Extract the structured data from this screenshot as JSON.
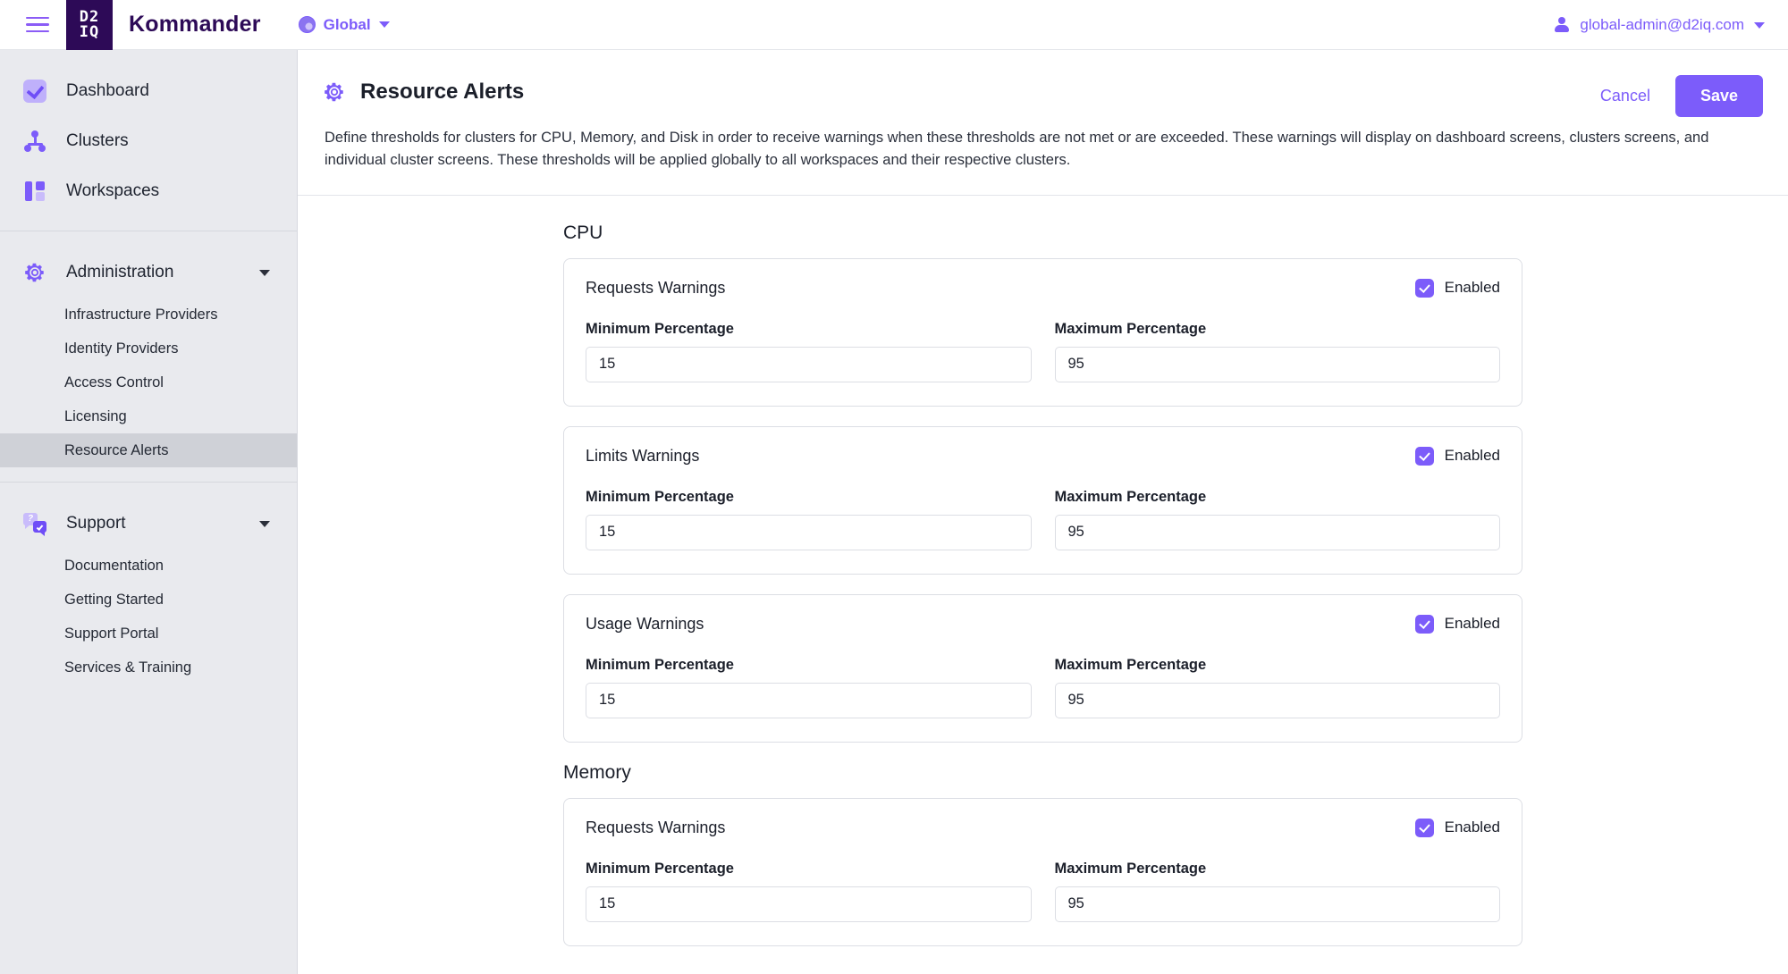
{
  "topbar": {
    "menu_icon": "hamburger-icon",
    "logo_line1": "D2",
    "logo_line2": "IQ",
    "brand": "Kommander",
    "scope_label": "Global",
    "scope_icon": "globe-icon",
    "user_icon": "user-icon",
    "user_email": "global-admin@d2iq.com",
    "accent": "#7c5cfa",
    "logo_bg": "#2d0a57"
  },
  "sidebar": {
    "primary": [
      {
        "label": "Dashboard",
        "icon": "dashboard-icon"
      },
      {
        "label": "Clusters",
        "icon": "clusters-icon"
      },
      {
        "label": "Workspaces",
        "icon": "workspaces-icon"
      }
    ],
    "administration": {
      "label": "Administration",
      "icon": "gear-icon",
      "expanded": true,
      "items": [
        {
          "label": "Infrastructure Providers",
          "active": false
        },
        {
          "label": "Identity Providers",
          "active": false
        },
        {
          "label": "Access Control",
          "active": false
        },
        {
          "label": "Licensing",
          "active": false
        },
        {
          "label": "Resource Alerts",
          "active": true
        }
      ]
    },
    "support": {
      "label": "Support",
      "icon": "support-icon",
      "expanded": true,
      "items": [
        {
          "label": "Documentation"
        },
        {
          "label": "Getting Started"
        },
        {
          "label": "Support Portal"
        },
        {
          "label": "Services & Training"
        }
      ]
    }
  },
  "page": {
    "icon": "gear-icon",
    "title": "Resource Alerts",
    "cancel_label": "Cancel",
    "save_label": "Save",
    "description": "Define thresholds for clusters for CPU, Memory, and Disk in order to receive warnings when these thresholds are not met or are exceeded. These warnings will display on dashboard screens, clusters screens, and individual cluster screens. These thresholds will be applied globally to all workspaces and their respective clusters."
  },
  "labels": {
    "enabled": "Enabled",
    "min_percentage": "Minimum Percentage",
    "max_percentage": "Maximum Percentage"
  },
  "sections": [
    {
      "title": "CPU",
      "cards": [
        {
          "title": "Requests Warnings",
          "enabled": true,
          "min": "15",
          "max": "95"
        },
        {
          "title": "Limits Warnings",
          "enabled": true,
          "min": "15",
          "max": "95"
        },
        {
          "title": "Usage Warnings",
          "enabled": true,
          "min": "15",
          "max": "95"
        }
      ]
    },
    {
      "title": "Memory",
      "cards": [
        {
          "title": "Requests Warnings",
          "enabled": true,
          "min": "15",
          "max": "95"
        }
      ]
    }
  ]
}
